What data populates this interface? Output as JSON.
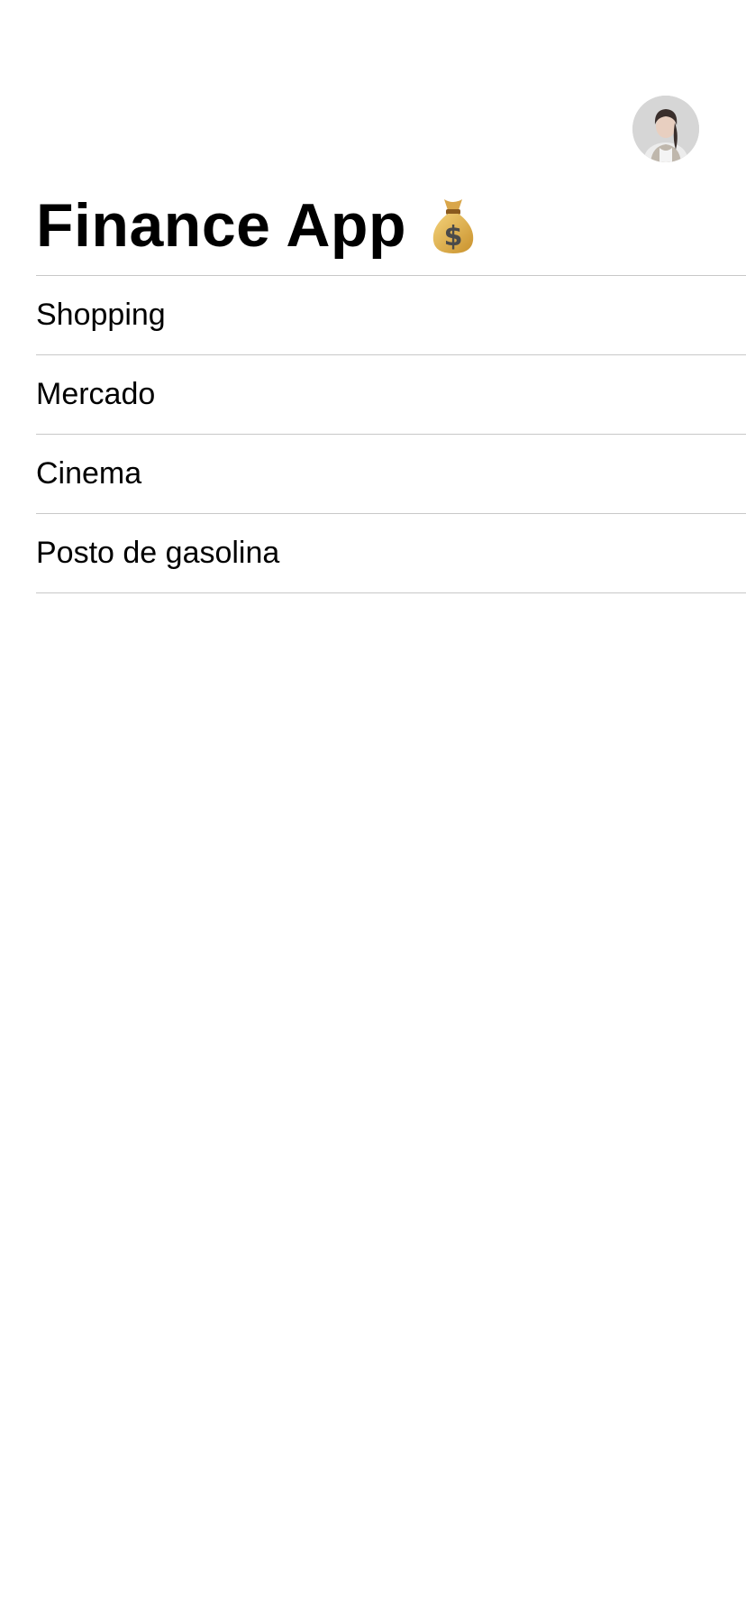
{
  "header": {
    "title": "Finance App",
    "title_icon": "money-bag-icon",
    "avatar": "profile-avatar"
  },
  "list": {
    "items": [
      {
        "label": "Shopping"
      },
      {
        "label": "Mercado"
      },
      {
        "label": "Cinema"
      },
      {
        "label": "Posto de gasolina"
      }
    ]
  },
  "colors": {
    "background": "#ffffff",
    "text": "#000000",
    "separator": "#c8c8c8"
  }
}
